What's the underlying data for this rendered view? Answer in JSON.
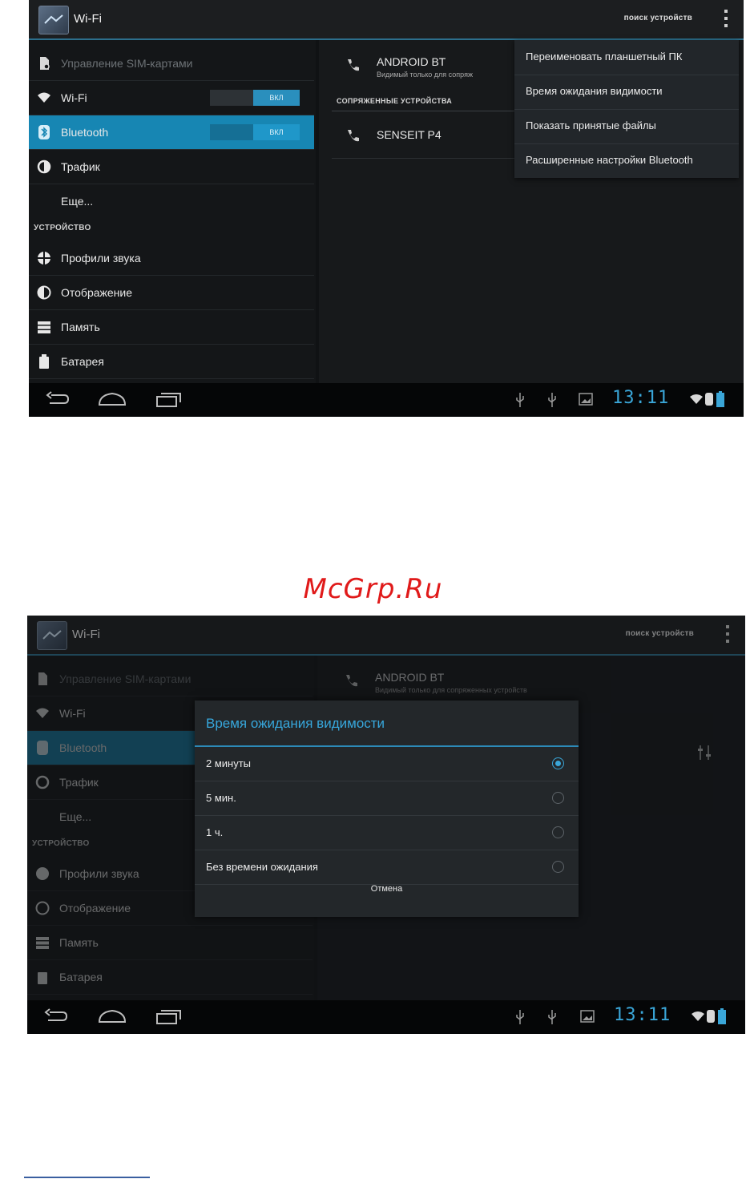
{
  "watermark": "McGrp.Ru",
  "colors": {
    "accent": "#1786b3",
    "holo_blue": "#3aa6d8",
    "watermark": "#e01a1a"
  },
  "screen1": {
    "action_bar": {
      "title": "Wi-Fi",
      "search_label": "поиск устройств",
      "app_icon": "settings-app-icon",
      "overflow_icon": "overflow-menu-icon"
    },
    "sidebar": {
      "items": [
        {
          "label": "Управление SIM-картами",
          "icon": "sim-icon"
        },
        {
          "label": "Wi-Fi",
          "icon": "wifi-icon",
          "toggle": "ВКЛ"
        },
        {
          "label": "Bluetooth",
          "icon": "bluetooth-icon",
          "toggle": "ВКЛ"
        },
        {
          "label": "Трафик",
          "icon": "data-usage-icon"
        },
        {
          "label": "Еще..."
        }
      ],
      "section_device": "УСТРОЙСТВО",
      "device_items": [
        {
          "label": "Профили звука",
          "icon": "sound-profiles-icon"
        },
        {
          "label": "Отображение",
          "icon": "display-icon"
        },
        {
          "label": "Память",
          "icon": "storage-icon"
        },
        {
          "label": "Батарея",
          "icon": "battery-icon"
        }
      ]
    },
    "content": {
      "this_device": {
        "name": "ANDROID BT",
        "subtitle": "Видимый только для сопряж"
      },
      "paired_header": "СОПРЯЖЕННЫЕ УСТРОЙСТВА",
      "paired": [
        {
          "name": "SENSEIT P4"
        }
      ]
    },
    "overflow_menu": [
      "Переименовать планшетный ПК",
      "Время ожидания видимости",
      "Показать принятые файлы",
      "Расширенные настройки Bluetooth"
    ],
    "status": {
      "time": "13:11"
    }
  },
  "screen2": {
    "action_bar": {
      "title": "Wi-Fi",
      "search_label": "поиск устройств"
    },
    "sidebar": {
      "items": [
        "Управление SIM-картами",
        "Wi-Fi",
        "Bluetooth",
        "Трафик",
        "Еще..."
      ],
      "section_device": "УСТРОЙСТВО",
      "device_items": [
        "Профили звука",
        "Отображение",
        "Память",
        "Батарея"
      ]
    },
    "content": {
      "this_device": {
        "name": "ANDROID BT",
        "subtitle": "Видимый только для сопряженных устройств"
      }
    },
    "dialog": {
      "title": "Время ожидания видимости",
      "options": [
        {
          "label": "2 минуты",
          "selected": true
        },
        {
          "label": "5 мин.",
          "selected": false
        },
        {
          "label": "1 ч.",
          "selected": false
        },
        {
          "label": "Без времени ожидания",
          "selected": false
        }
      ],
      "cancel": "Отмена"
    },
    "status": {
      "time": "13:11"
    }
  }
}
